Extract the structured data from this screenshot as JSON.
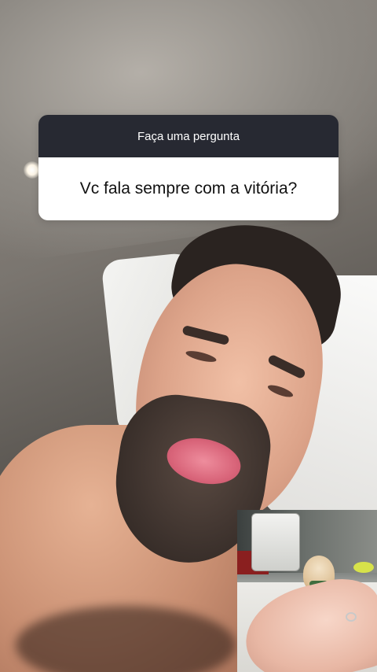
{
  "question_box": {
    "header": "Faça uma pergunta",
    "question": "Vc fala sempre com a vitória?"
  }
}
